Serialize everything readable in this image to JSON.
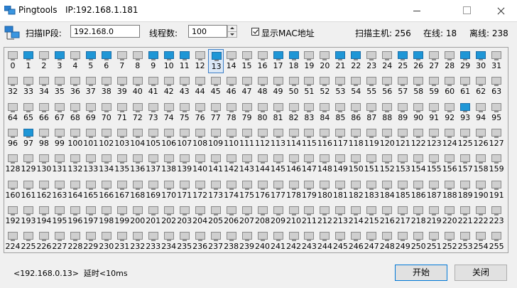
{
  "window": {
    "title": "Pingtools   IP:192.168.1.181"
  },
  "toolbar": {
    "scan_label": "扫描IP段:",
    "scan_value": "192.168.0",
    "threads_label": "线程数:",
    "threads_value": "100",
    "show_mac_label": "显示MAC地址",
    "show_mac_checked": true,
    "hosts_label": "扫描主机: 256",
    "online_label": "在线: 18",
    "offline_label": "离线: 238"
  },
  "hosts": {
    "online": [
      1,
      3,
      5,
      6,
      9,
      10,
      11,
      13,
      17,
      18,
      21,
      22,
      25,
      26,
      29,
      30,
      93,
      97
    ],
    "selected": 13
  },
  "status": {
    "text": "<192.168.0.13>  延时<10ms"
  },
  "buttons": {
    "start": "开始",
    "close": "关闭"
  },
  "colors": {
    "online": "#1e96d6",
    "offline": "#cfcfcf",
    "selected_border": "#3c7fc8"
  }
}
